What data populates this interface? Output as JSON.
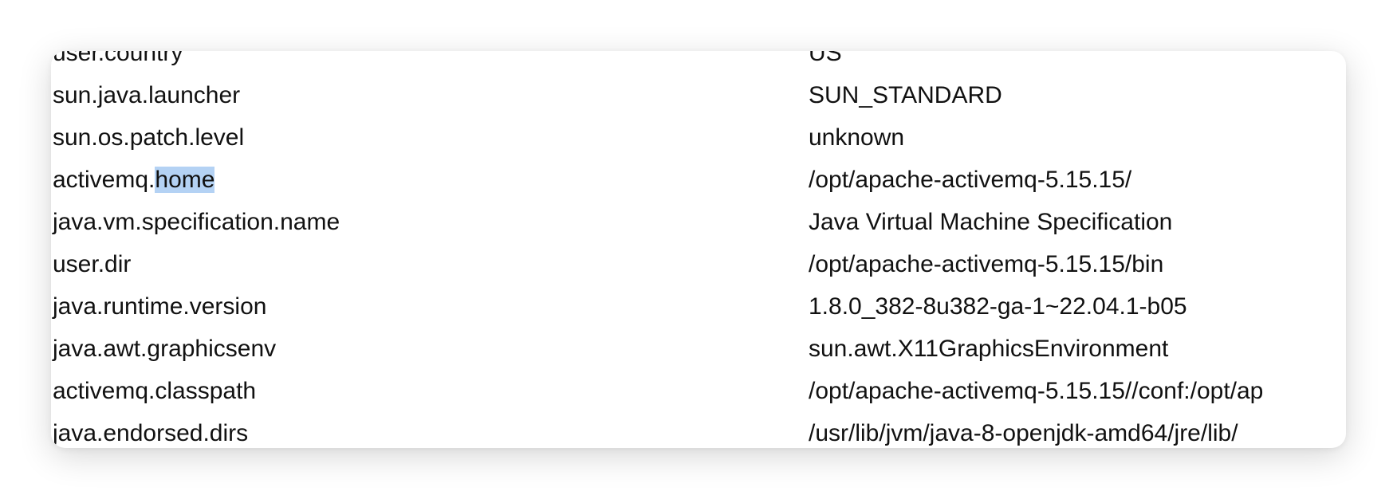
{
  "rows": [
    {
      "key": "user.country",
      "value": "US"
    },
    {
      "key": "sun.java.launcher",
      "value": "SUN_STANDARD"
    },
    {
      "key": "sun.os.patch.level",
      "value": "unknown"
    },
    {
      "key_prefix": "activemq.",
      "key_selected": "home",
      "value": "/opt/apache-activemq-5.15.15/"
    },
    {
      "key": "java.vm.specification.name",
      "value": "Java Virtual Machine Specification"
    },
    {
      "key": "user.dir",
      "value": "/opt/apache-activemq-5.15.15/bin"
    },
    {
      "key": "java.runtime.version",
      "value": "1.8.0_382-8u382-ga-1~22.04.1-b05"
    },
    {
      "key": "java.awt.graphicsenv",
      "value": "sun.awt.X11GraphicsEnvironment"
    },
    {
      "key": "activemq.classpath",
      "value": "/opt/apache-activemq-5.15.15//conf:/opt/ap"
    },
    {
      "key": "java.endorsed.dirs",
      "value": "/usr/lib/jvm/java-8-openjdk-amd64/jre/lib/"
    }
  ],
  "colors": {
    "text": "#111111",
    "selection": "#b4d2f4",
    "background": "#ffffff"
  }
}
